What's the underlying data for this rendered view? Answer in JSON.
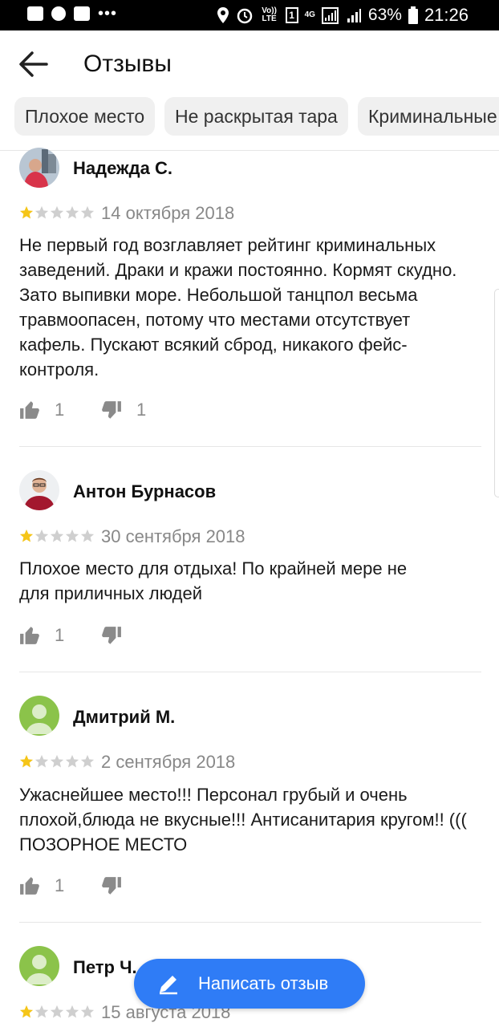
{
  "status_bar": {
    "volte": "Vo)) LTE",
    "sim": "1",
    "net": "4G",
    "battery": "63%",
    "time": "21:26",
    "icons": [
      "gallery-icon",
      "message-icon",
      "sim-card-icon",
      "more-icon",
      "location-icon",
      "alarm-icon",
      "wifi-icon",
      "signal-icon"
    ]
  },
  "header": {
    "title": "Отзывы",
    "back_icon": "arrow-left-icon"
  },
  "chips": [
    "Плохое место",
    "Не раскрытая тара",
    "Криминальные"
  ],
  "reviews": [
    {
      "author": "Надежда С.",
      "rating": 1,
      "date": "14 октября 2018",
      "text": "Не первый год возглавляет рейтинг криминальных заведений. Драки и кражи постоянно. Кормят скудно. Зато выпивки море. Небольшой танцпол весьма травмоопасен, потому что местами отсутствует кафель. Пускают всякий сброд, никакого фейс-контроля.",
      "likes": "1",
      "dislikes": "1"
    },
    {
      "author": "Антон Бурнасов",
      "rating": 1,
      "date": "30 сентября 2018",
      "text": "Плохое место для отдыха! По крайней мере не для приличных людей",
      "likes": "1",
      "dislikes": ""
    },
    {
      "author": "Дмитрий М.",
      "rating": 1,
      "date": "2 сентября 2018",
      "text": "Ужаснейшее место!!! Персонал грубый и очень плохой,блюда не вкусные!!! Антисанитария кругом!! ((( ПОЗОРНОЕ МЕСТО",
      "likes": "1",
      "dislikes": ""
    },
    {
      "author": "Петр Ч.",
      "rating": 1,
      "date": "15 августа 2018",
      "text": "",
      "likes": "",
      "dislikes": ""
    }
  ],
  "fab": {
    "label": "Написать отзыв",
    "icon": "pencil-icon"
  },
  "colors": {
    "accent": "#2f7cf6",
    "star_filled": "#f5c518",
    "star_empty": "#cfcfcf",
    "chip_bg": "#f0f0f0"
  }
}
